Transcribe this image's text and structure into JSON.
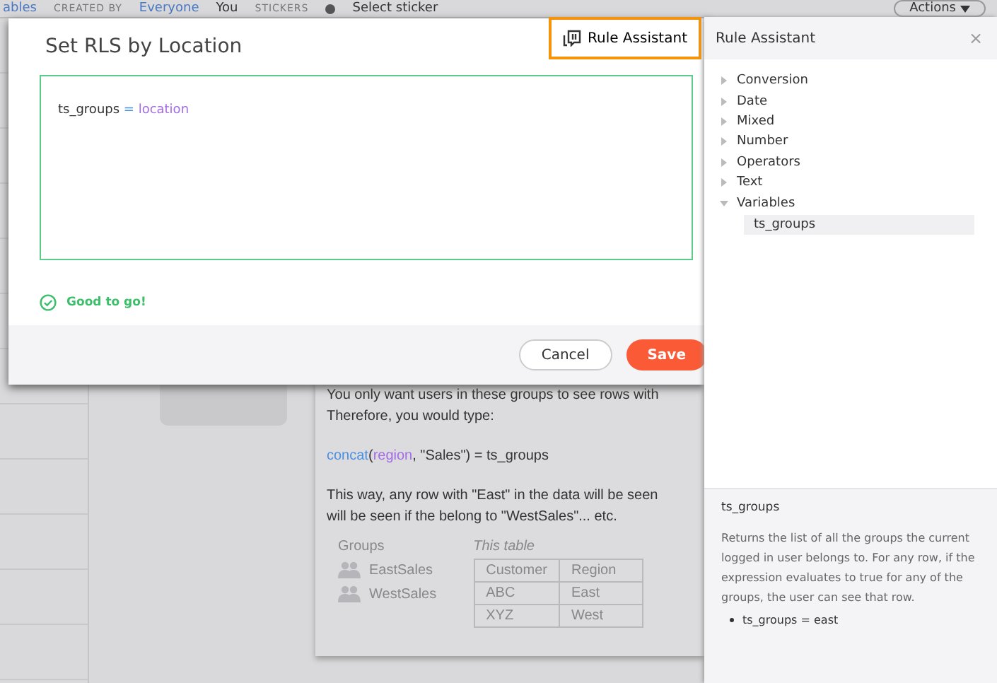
{
  "background_page": {
    "top_bar": {
      "tab": "ables",
      "created_by_label": "CREATED BY",
      "created_by_options": [
        {
          "label": "Everyone",
          "selected": true
        },
        {
          "label": "You",
          "selected": false
        }
      ],
      "stickers_label": "STICKERS",
      "sticker_select": "Select sticker",
      "actions_button": "Actions"
    },
    "tutorial_card": {
      "paragraphs": [
        "You only want users in these groups to see rows with",
        "Therefore, you would type:"
      ],
      "code": [
        {
          "text": "concat",
          "kind": "function"
        },
        {
          "text": "(",
          "kind": "plain"
        },
        {
          "text": "region",
          "kind": "column"
        },
        {
          "text": ", \"Sales\") = ts_groups",
          "kind": "plain"
        }
      ],
      "note": [
        "This way, any row with \"East\" in the data will be seen",
        "will be seen if the belong to \"WestSales\"... etc."
      ],
      "groups_heading": "Groups",
      "groups": [
        "EastSales",
        "WestSales"
      ],
      "table_heading": "This table",
      "table": {
        "columns": [
          "Customer",
          "Region"
        ],
        "rows": [
          [
            "ABC",
            "East"
          ],
          [
            "XYZ",
            "West"
          ]
        ]
      }
    }
  },
  "dialog": {
    "title": "Set RLS by Location",
    "rule_assistant_button": {
      "label": "Rule Assistant",
      "highlighted": true
    },
    "editor": [
      {
        "text": "ts_groups",
        "kind": "plain"
      },
      {
        "text": " = ",
        "kind": "operator"
      },
      {
        "text": "location",
        "kind": "column"
      }
    ],
    "status": {
      "text": "Good to go!",
      "valid": true
    },
    "buttons": [
      {
        "label": "Cancel",
        "kind": "secondary"
      },
      {
        "label": "Save",
        "kind": "primary"
      }
    ]
  },
  "rule_assistant": {
    "title": "Rule Assistant",
    "close": "×",
    "tree": [
      {
        "label": "Conversion",
        "expanded": false
      },
      {
        "label": "Date",
        "expanded": false
      },
      {
        "label": "Mixed",
        "expanded": false
      },
      {
        "label": "Number",
        "expanded": false
      },
      {
        "label": "Operators",
        "expanded": false
      },
      {
        "label": "Text",
        "expanded": false
      },
      {
        "label": "Variables",
        "expanded": true,
        "children": [
          {
            "label": "ts_groups",
            "selected": true
          }
        ]
      }
    ],
    "detail": {
      "title": "ts_groups",
      "description": "Returns the list of all the groups the current logged in user belongs to. For any row, if the expression evaluates to true for any of the groups, the user can see that row.",
      "examples": [
        "ts_groups = east"
      ]
    }
  }
}
